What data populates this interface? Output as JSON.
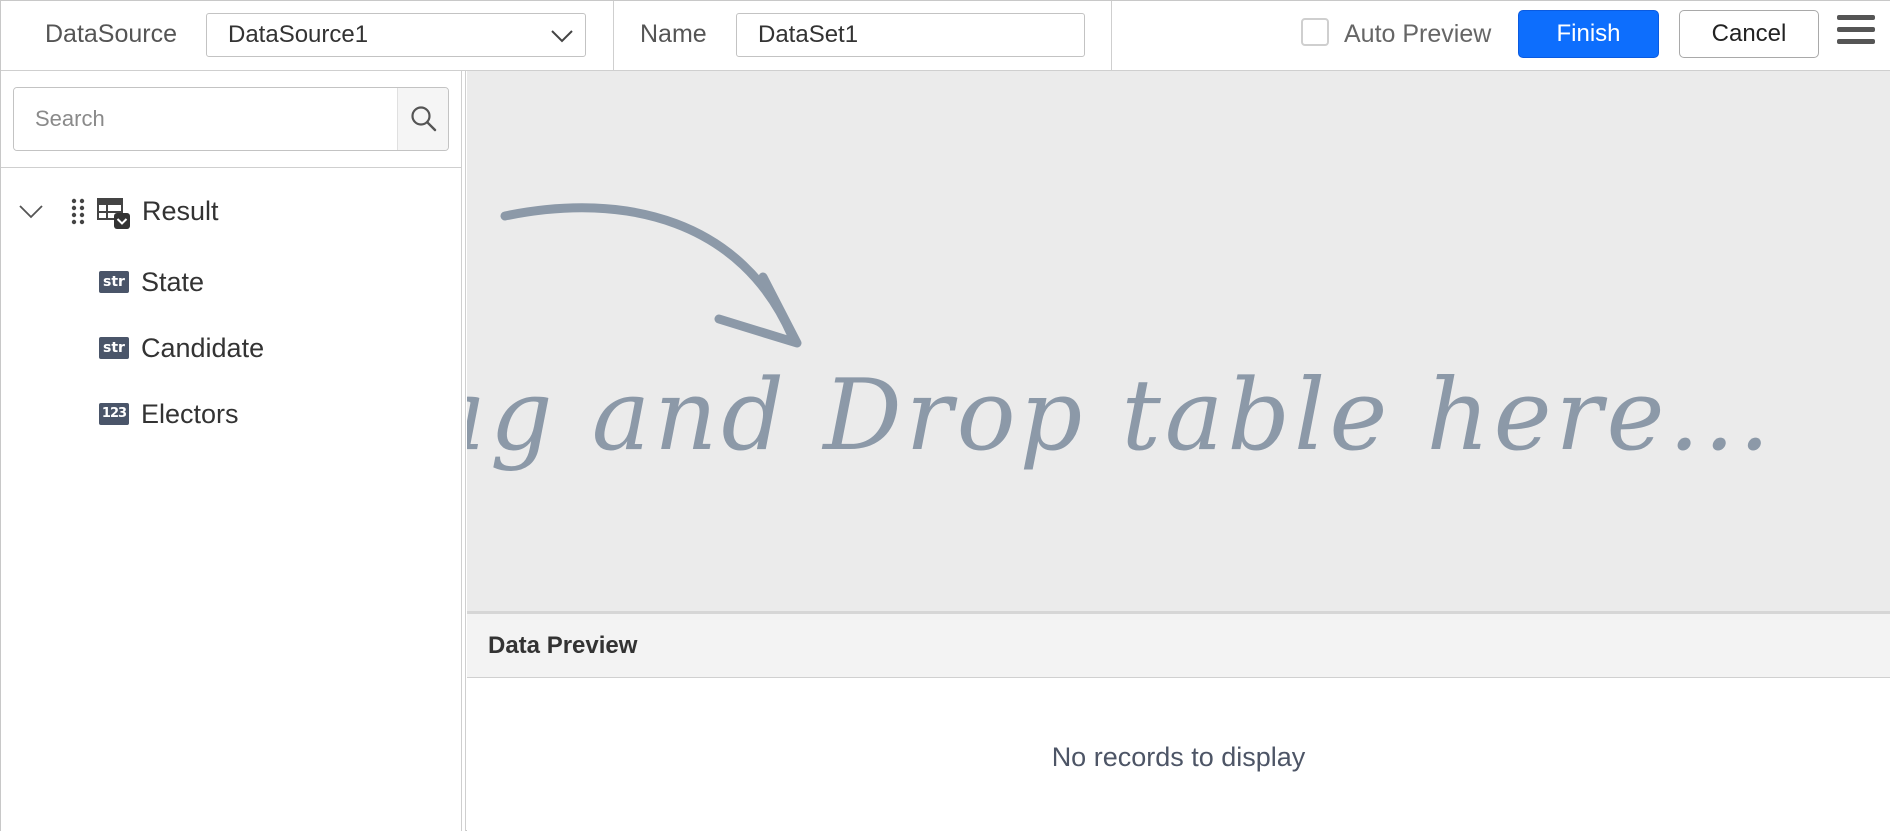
{
  "toolbar": {
    "datasource_label": "DataSource",
    "datasource_value": "DataSource1",
    "name_label": "Name",
    "name_value": "DataSet1",
    "auto_preview_label": "Auto Preview",
    "auto_preview_checked": false,
    "finish_label": "Finish",
    "cancel_label": "Cancel",
    "menu_icon": "hamburger-menu-icon"
  },
  "sidebar": {
    "search_placeholder": "Search",
    "search_icon": "search-icon",
    "tree": {
      "root": {
        "label": "Result",
        "expanded": true,
        "icon": "table-icon"
      },
      "children": [
        {
          "label": "State",
          "type": "str"
        },
        {
          "label": "Candidate",
          "type": "str"
        },
        {
          "label": "Electors",
          "type": "123"
        }
      ]
    }
  },
  "drop_area": {
    "hint_text": "Drag and Drop table here..."
  },
  "preview": {
    "title": "Data Preview",
    "empty_text": "No records to display"
  },
  "colors": {
    "accent": "#0d6efd",
    "drop_area_bg": "#ebebeb",
    "hint_color": "#8c99a8",
    "badge_bg": "#4a5569"
  }
}
